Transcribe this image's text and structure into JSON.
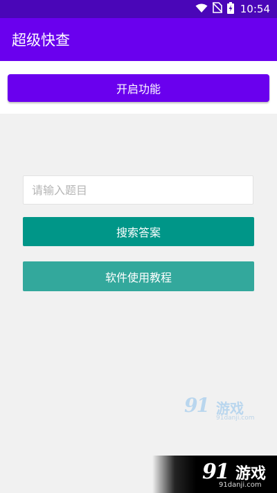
{
  "status_bar": {
    "time": "10:54",
    "icons": [
      "wifi-icon",
      "no-sim-icon",
      "battery-charging-icon"
    ]
  },
  "app_bar": {
    "title": "超级快查"
  },
  "actions": {
    "enable_label": "开启功能"
  },
  "search": {
    "placeholder": "请输入题目",
    "value": "",
    "search_label": "搜索答案",
    "tutorial_label": "软件使用教程"
  },
  "watermark": {
    "brand_number": "91",
    "brand_name": "游戏",
    "url": "91danji.com"
  },
  "colors": {
    "status_bar": "#4a06b8",
    "app_bar": "#6a00ee",
    "search_button": "#009688",
    "tutorial_button": "#33a89c"
  }
}
